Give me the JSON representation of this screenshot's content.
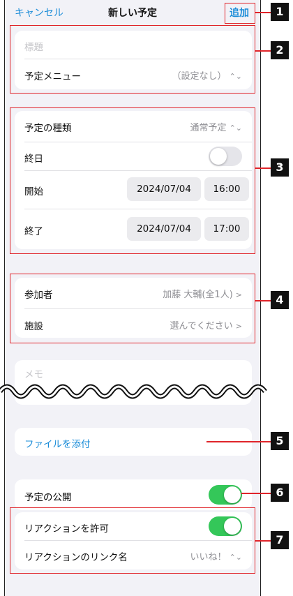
{
  "nav": {
    "cancel": "キャンセル",
    "title": "新しい予定",
    "add": "追加"
  },
  "section1": {
    "title_placeholder": "標題",
    "menu_label": "予定メニュー",
    "menu_value": "（設定なし）"
  },
  "section2": {
    "type_label": "予定の種類",
    "type_value": "通常予定",
    "allday_label": "終日",
    "allday_on": false,
    "start_label": "開始",
    "start_date": "2024/07/04",
    "start_time": "16:00",
    "end_label": "終了",
    "end_date": "2024/07/04",
    "end_time": "17:00"
  },
  "section3": {
    "attendees_label": "参加者",
    "attendees_value": "加藤 大輔(全1人)",
    "facility_label": "施設",
    "facility_value": "選んでください"
  },
  "memo": {
    "placeholder": "メモ"
  },
  "attach": {
    "label": "ファイルを添付"
  },
  "publish": {
    "label": "予定の公開",
    "on": true
  },
  "reaction": {
    "allow_label": "リアクションを許可",
    "allow_on": true,
    "link_label": "リアクションのリンク名",
    "link_value": "いいね！"
  },
  "badges": [
    "1",
    "2",
    "3",
    "4",
    "5",
    "6",
    "7"
  ],
  "colors": {
    "accent": "#1a8cd8",
    "toggle_on": "#34c759",
    "callout": "#e0242a"
  }
}
